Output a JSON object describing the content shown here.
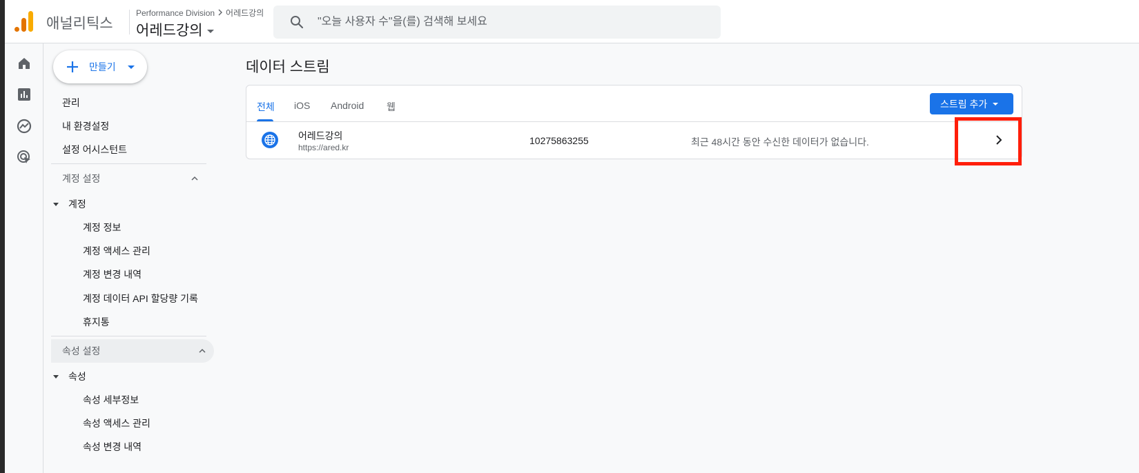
{
  "header": {
    "product_name": "애널리틱스",
    "breadcrumb_account": "Performance Division",
    "breadcrumb_property": "어레드강의",
    "property_name": "어레드강의",
    "search_placeholder": "\"오늘 사용자 수\"을(를) 검색해 보세요"
  },
  "rail": {
    "items": [
      "home-icon",
      "reports-icon",
      "explore-icon",
      "advertising-icon"
    ]
  },
  "nav": {
    "create_label": "만들기",
    "top_items": [
      "관리",
      "내 환경설정",
      "설정 어시스턴트"
    ],
    "account_section": {
      "title": "계정 설정",
      "parent": "계정",
      "children": [
        "계정 정보",
        "계정 액세스 관리",
        "계정 변경 내역",
        "계정 데이터 API 할당량 기록",
        "휴지통"
      ]
    },
    "property_section": {
      "title": "속성 설정",
      "parent": "속성",
      "children": [
        "속성 세부정보",
        "속성 액세스 관리",
        "속성 변경 내역"
      ]
    }
  },
  "main": {
    "title": "데이터 스트림",
    "tabs": [
      "전체",
      "iOS",
      "Android",
      "웹"
    ],
    "active_tab": "전체",
    "add_stream_label": "스트림 추가",
    "stream": {
      "name": "어레드강의",
      "url": "https://ared.kr",
      "id": "10275863255",
      "status": "최근 48시간 동안 수신한 데이터가 없습니다."
    }
  },
  "colors": {
    "accent": "#1a73e8",
    "highlight": "#ff1e0a"
  }
}
